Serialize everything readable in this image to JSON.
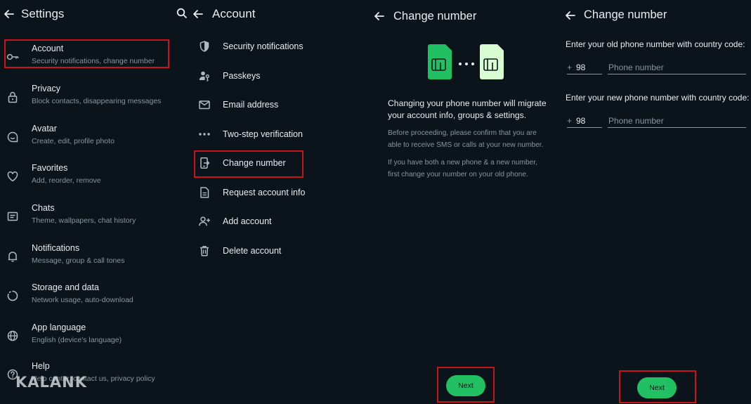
{
  "settings": {
    "title": "Settings",
    "items": [
      {
        "title": "Account",
        "subtitle": "Security notifications, change number",
        "icon": "key-icon"
      },
      {
        "title": "Privacy",
        "subtitle": "Block contacts, disappearing messages",
        "icon": "lock-icon"
      },
      {
        "title": "Avatar",
        "subtitle": "Create, edit, profile photo",
        "icon": "avatar-icon"
      },
      {
        "title": "Favorites",
        "subtitle": "Add, reorder, remove",
        "icon": "heart-icon"
      },
      {
        "title": "Chats",
        "subtitle": "Theme, wallpapers, chat history",
        "icon": "chat-icon"
      },
      {
        "title": "Notifications",
        "subtitle": "Message, group & call tones",
        "icon": "bell-icon"
      },
      {
        "title": "Storage and data",
        "subtitle": "Network usage, auto-download",
        "icon": "storage-icon"
      },
      {
        "title": "App language",
        "subtitle": "English (device's language)",
        "icon": "globe-icon"
      },
      {
        "title": "Help",
        "subtitle": "Help center, contact us, privacy policy",
        "icon": "help-icon"
      }
    ]
  },
  "account": {
    "title": "Account",
    "items": [
      {
        "label": "Security notifications",
        "icon": "shield-icon"
      },
      {
        "label": "Passkeys",
        "icon": "passkey-icon"
      },
      {
        "label": "Email address",
        "icon": "mail-icon"
      },
      {
        "label": "Two-step verification",
        "icon": "dots-icon"
      },
      {
        "label": "Change number",
        "icon": "phone-transfer-icon"
      },
      {
        "label": "Request account info",
        "icon": "document-icon"
      },
      {
        "label": "Add account",
        "icon": "add-person-icon"
      },
      {
        "label": "Delete account",
        "icon": "trash-icon"
      }
    ]
  },
  "change_number_intro": {
    "title": "Change number",
    "main_text": "Changing your phone number will migrate your account info, groups & settings.",
    "note_1": "Before proceeding, please confirm that you are able to receive SMS or calls at your new number.",
    "note_2": "If you have both a new phone & a new number, first change your number on your old phone.",
    "next_label": "Next"
  },
  "change_number_form": {
    "title": "Change number",
    "old_label": "Enter your old phone number with country code:",
    "new_label": "Enter your new phone number with country code:",
    "plus": "+",
    "old_code": "98",
    "new_code": "98",
    "old_placeholder": "Phone number",
    "new_placeholder": "Phone number",
    "next_label": "Next"
  },
  "watermark": "KALANK",
  "colors": {
    "accent": "#21c063",
    "highlight": "#c8151b",
    "background": "#0b141a",
    "sim_old": "#21c063",
    "sim_new": "#d9fdd3"
  }
}
